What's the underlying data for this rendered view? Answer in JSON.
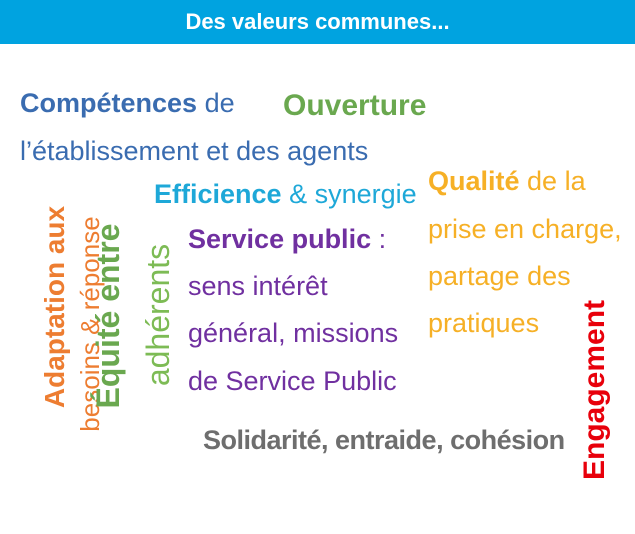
{
  "header": {
    "title": "Des valeurs communes..."
  },
  "colors": {
    "header_bg": "#00a3e0",
    "blue": "#3a6cb0",
    "green": "#6aa84f",
    "orange": "#ed7d31",
    "cyan": "#1ea8d8",
    "purple": "#7030a0",
    "yellow": "#f6b026",
    "red": "#e8000b",
    "gray": "#6e6e6e",
    "light_green": "#7dbb55"
  },
  "words": {
    "competences_bold": "Compétences",
    "competences_rest": " de",
    "etablissement": "l’établissement et des agents",
    "ouverture": "Ouverture",
    "efficience_bold": "Efficience",
    "efficience_rest": " & synergie",
    "qualite_bold": "Qualité",
    "qualite_rest": " de la",
    "qualite_line2": "prise en charge,",
    "qualite_line3": "partage des",
    "qualite_line4": "pratiques",
    "service_bold": "Service public",
    "service_rest": " :",
    "service_line2": "sens intérêt",
    "service_line3": "général, missions",
    "service_line4": "de Service Public",
    "adaptation": "Adaptation aux",
    "besoins": "besoins & réponse",
    "equite": "Équité entre",
    "adherents": "adhérents",
    "engagement": "Engagement",
    "solidarite": "Solidarité, entraide, cohésion"
  }
}
